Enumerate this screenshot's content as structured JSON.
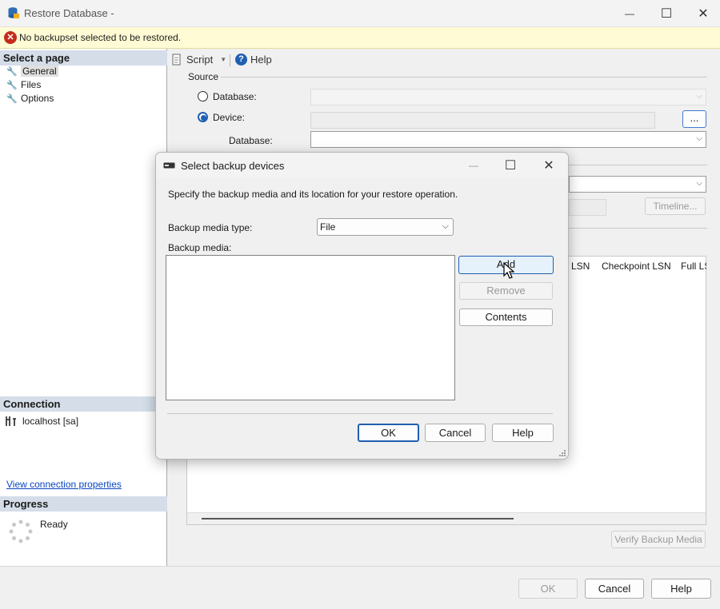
{
  "window": {
    "title": "Restore Database -",
    "minimize_glyph": "—",
    "maximize_glyph": "☐",
    "close_glyph": "✕"
  },
  "error_bar": {
    "message": "No backupset selected to be restored."
  },
  "left_pane": {
    "select_page_header": "Select a page",
    "pages": [
      {
        "label": "General",
        "selected": true
      },
      {
        "label": "Files",
        "selected": false
      },
      {
        "label": "Options",
        "selected": false
      }
    ],
    "connection_header": "Connection",
    "connection_server": "localhost [sa]",
    "view_connection_link": "View connection properties",
    "progress_header": "Progress",
    "progress_status": "Ready"
  },
  "toolbar": {
    "script_label": "Script",
    "help_label": "Help"
  },
  "source": {
    "group_label": "Source",
    "database_radio_label": "Database:",
    "device_radio_label": "Device:",
    "database_sub_label": "Database:",
    "browse_button": "...",
    "selected_option": "Device"
  },
  "destination": {
    "timeline_button": "Timeline..."
  },
  "backup_grid": {
    "columns": [
      "LSN",
      "Checkpoint LSN",
      "Full LS"
    ]
  },
  "verify_button": "Verify Backup Media",
  "bottom_buttons": {
    "ok": "OK",
    "cancel": "Cancel",
    "help": "Help"
  },
  "dialog": {
    "title": "Select backup devices",
    "description": "Specify the backup media and its location for your restore operation.",
    "media_type_label": "Backup media type:",
    "media_type_value": "File",
    "backup_media_label": "Backup media:",
    "add_button": "Add",
    "remove_button": "Remove",
    "contents_button": "Contents",
    "ok_button": "OK",
    "cancel_button": "Cancel",
    "help_button": "Help"
  },
  "colors": {
    "accent": "#1f5fb0",
    "error": "#c42b1c",
    "warning_bg": "#fffbd4",
    "section_header_bg": "#d4dde8"
  }
}
